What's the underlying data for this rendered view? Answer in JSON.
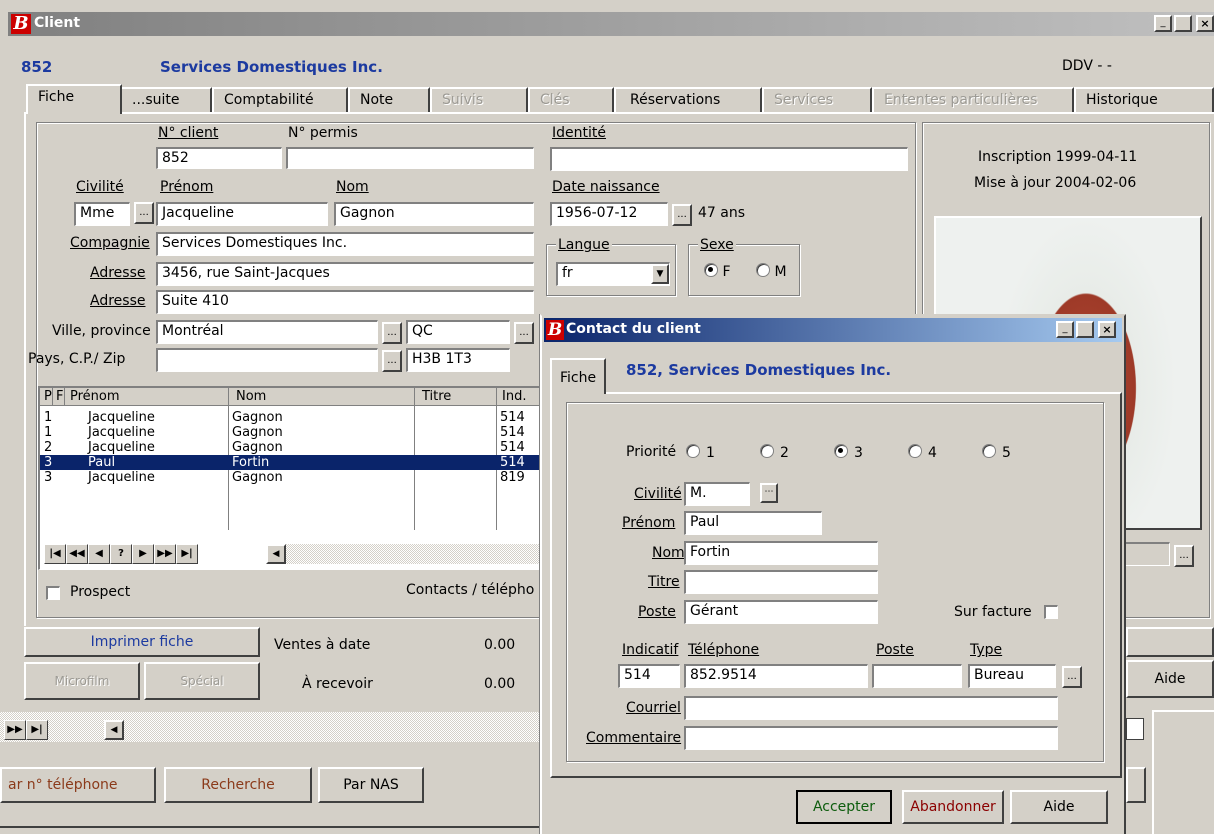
{
  "main": {
    "title": "Client",
    "client_id": "852",
    "client_name": "Services Domestiques Inc.",
    "ddv": "DDV  - -",
    "tabs": [
      "Fiche",
      "...suite",
      "Comptabilité",
      "Note",
      "Suivis",
      "Clés",
      "Réservations",
      "Services",
      "Ententes particulières",
      "Historique"
    ],
    "labels": {
      "no_client": "N° client",
      "no_permis": "N° permis",
      "identite": "Identité",
      "civilite": "Civilité",
      "prenom": "Prénom",
      "nom": "Nom",
      "date_naissance": "Date naissance",
      "compagnie": "Compagnie",
      "adresse1": "Adresse",
      "adresse2": "Adresse",
      "ville": "Ville, province",
      "pays": "Pays, C.P./ Zip",
      "langue": "Langue",
      "sexe": "Sexe",
      "sexe_f": "F",
      "sexe_m": "M",
      "prospect": "Prospect",
      "contacts": "Contacts / télépho"
    },
    "values": {
      "no_client": "852",
      "no_permis": "",
      "identite": "",
      "civilite": "Mme",
      "prenom": "Jacqueline",
      "nom": "Gagnon",
      "date_naissance": "1956-07-12",
      "age": "47 ans",
      "compagnie": "Services Domestiques Inc.",
      "adresse1": "3456, rue Saint-Jacques",
      "adresse2": "Suite 410",
      "ville": "Montréal",
      "province": "QC",
      "pays": "",
      "zip": "H3B 1T3",
      "langue": "fr"
    },
    "info": {
      "inscription": "Inscription 1999-04-11",
      "mise_a_jour": "Mise à jour 2004-02-06"
    },
    "grid": {
      "headers": [
        "P",
        "F",
        "Prénom",
        "Nom",
        "Titre",
        "Ind."
      ],
      "rows": [
        {
          "p": "1",
          "prenom": "Jacqueline",
          "nom": "Gagnon",
          "ind": "514"
        },
        {
          "p": "1",
          "prenom": "Jacqueline",
          "nom": "Gagnon",
          "ind": "514"
        },
        {
          "p": "2",
          "prenom": "Jacqueline",
          "nom": "Gagnon",
          "ind": "514"
        },
        {
          "p": "3",
          "prenom": "Paul",
          "nom": "Fortin",
          "ind": "514"
        },
        {
          "p": "3",
          "prenom": "Jacqueline",
          "nom": "Gagnon",
          "ind": "819"
        }
      ],
      "selected_index": 3
    },
    "bottom": {
      "imprimer": "Imprimer fiche",
      "microfilm": "Microfilm",
      "special": "Spécial",
      "ventes_label": "Ventes à date",
      "ventes_value": "0.00",
      "recevoir_label": "À recevoir",
      "recevoir_value": "0.00",
      "aide": "Aide",
      "par_telephone": "ar n° téléphone",
      "recherche": "Recherche",
      "par_nas": "Par NAS"
    }
  },
  "dialog": {
    "title": "Contact du client",
    "tab": "Fiche",
    "header": "852, Services Domestiques Inc.",
    "priorite_label": "Priorité",
    "priorite_options": [
      "1",
      "2",
      "3",
      "4",
      "5"
    ],
    "priorite_selected": "3",
    "labels": {
      "civilite": "Civilité",
      "prenom": "Prénom",
      "nom": "Nom",
      "titre": "Titre",
      "poste": "Poste",
      "sur_facture": "Sur facture",
      "indicatif": "Indicatif",
      "telephone": "Téléphone",
      "poste_tel": "Poste",
      "type": "Type",
      "courriel": "Courriel",
      "commentaire": "Commentaire"
    },
    "values": {
      "civilite": "M.",
      "prenom": "Paul",
      "nom": "Fortin",
      "titre": "",
      "poste": "Gérant",
      "indicatif": "514",
      "telephone": "852.9514",
      "poste_tel": "",
      "type": "Bureau",
      "courriel": "",
      "commentaire": ""
    },
    "buttons": {
      "accepter": "Accepter",
      "abandonner": "Abandonner",
      "aide": "Aide"
    }
  },
  "colors": {
    "title_active": "#0a246a",
    "title_inactive": "#808080",
    "selection": "#0a246a",
    "client_blue": "#1c3aa0",
    "logo_red": "#cc0000"
  }
}
